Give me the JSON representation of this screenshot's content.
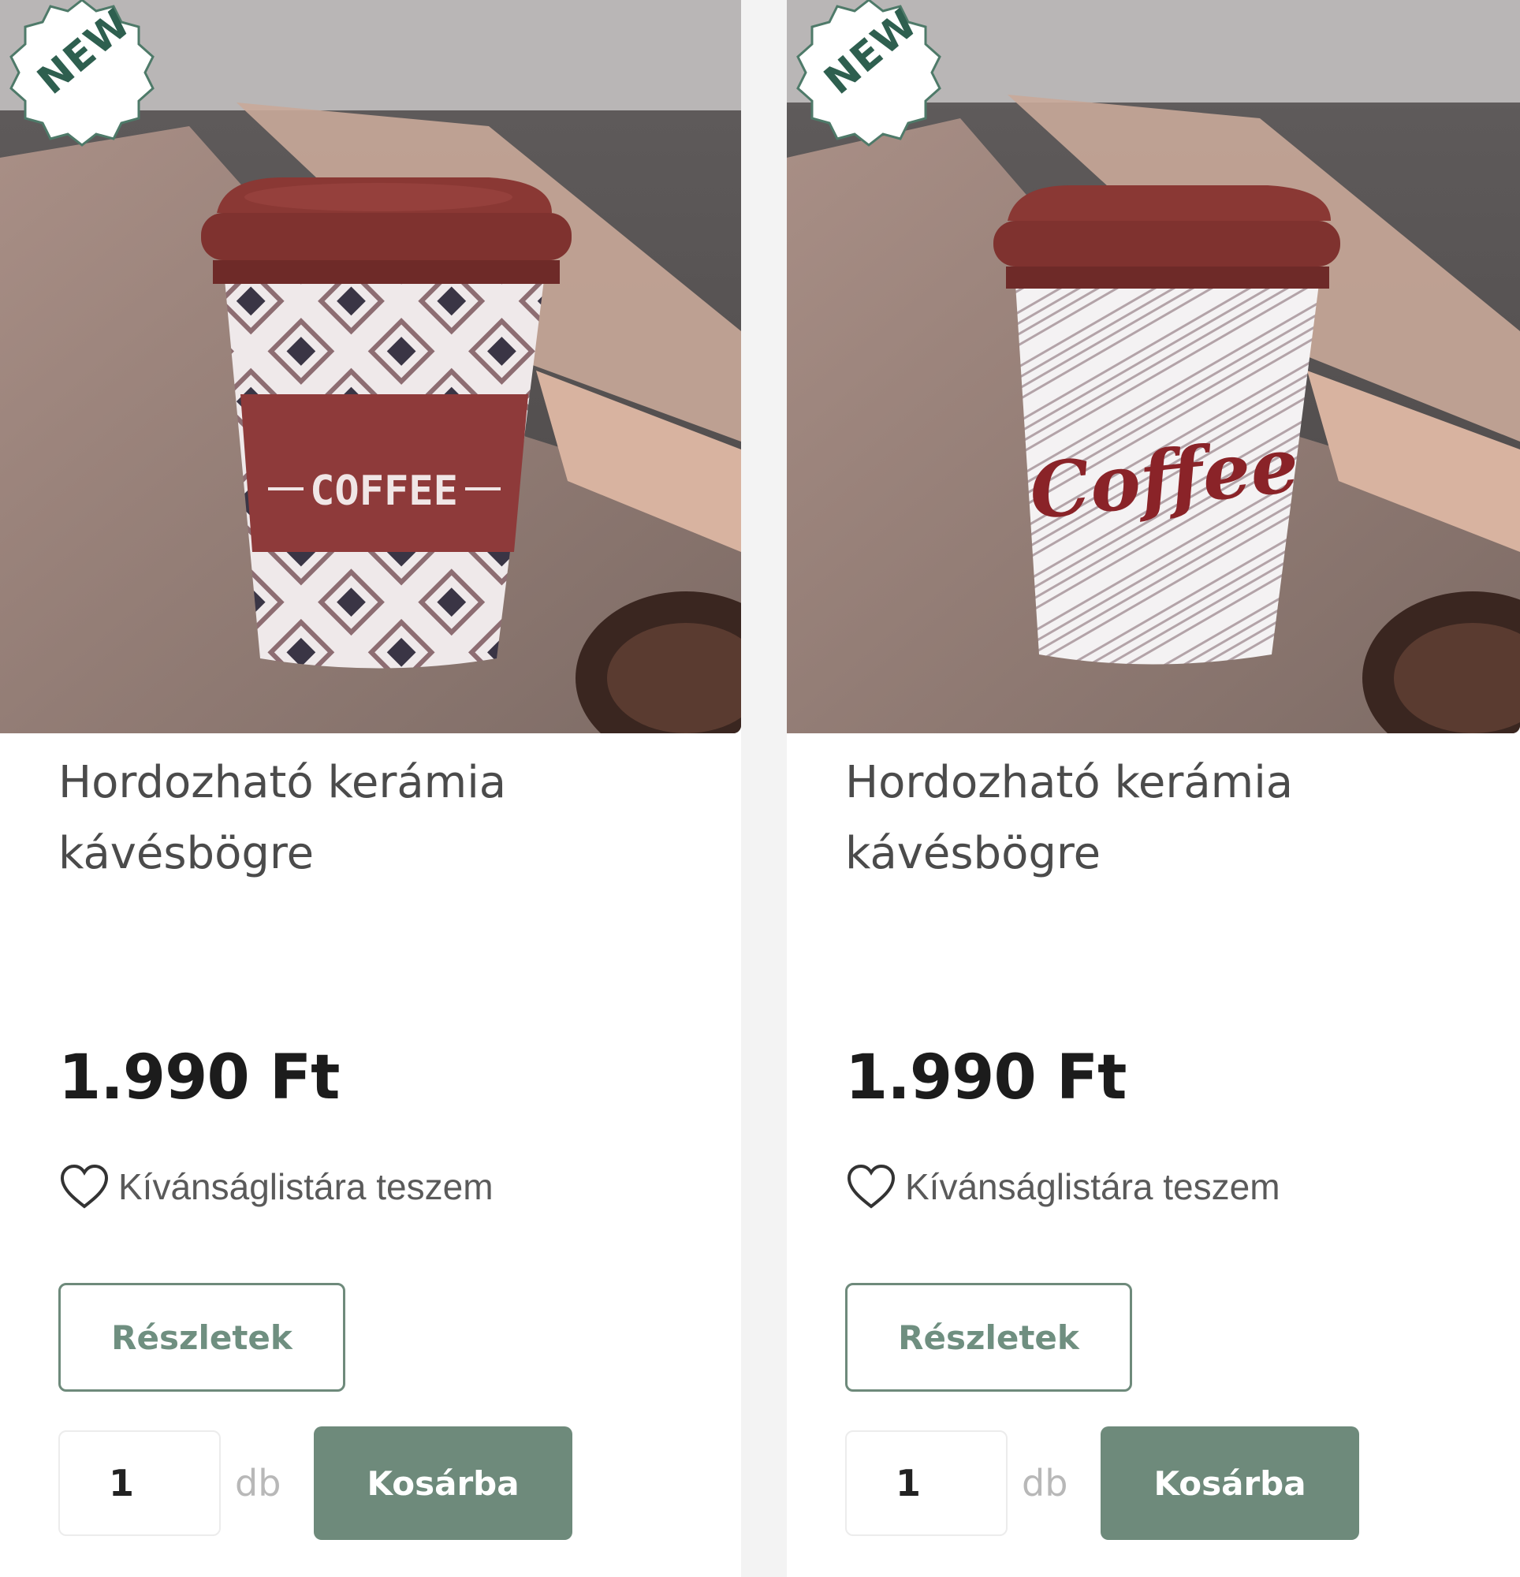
{
  "colors": {
    "accent": "#6e8a7b",
    "badge_text": "#2e5f4f",
    "price": "#1c1c1c",
    "title": "#4b4b4b",
    "lid": "#8e3a34"
  },
  "products": [
    {
      "badge": "NEW",
      "cup_text": "COFFEE",
      "title_line1": "Hordozható kerámia",
      "title_line2": "kávésbögre",
      "price": "1.990 Ft",
      "wishlist_label": "Kívánságlistára teszem",
      "wishlist_icon": "heart-outline-icon",
      "details_label": "Részletek",
      "quantity": "1",
      "unit": "db",
      "cart_label": "Kosárba"
    },
    {
      "badge": "NEW",
      "cup_text": "Coffee",
      "title_line1": "Hordozható kerámia",
      "title_line2": "kávésbögre",
      "price": "1.990 Ft",
      "wishlist_label": "Kívánságlistára teszem",
      "wishlist_icon": "heart-outline-icon",
      "details_label": "Részletek",
      "quantity": "1",
      "unit": "db",
      "cart_label": "Kosárba"
    }
  ]
}
